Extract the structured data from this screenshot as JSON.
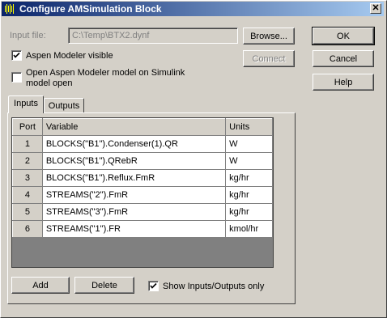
{
  "window": {
    "title": "Configure AMSimulation Block"
  },
  "input_file": {
    "label": "Input file:",
    "value": "C:\\Temp\\BTX2.dynf"
  },
  "buttons": {
    "browse": "Browse...",
    "connect": "Connect",
    "ok": "OK",
    "cancel": "Cancel",
    "help": "Help",
    "add": "Add",
    "delete": "Delete"
  },
  "options": {
    "aspen_visible": {
      "label": "Aspen Modeler visible",
      "checked": true
    },
    "open_on_simulink": {
      "label_line1": "Open Aspen Modeler model on Simulink",
      "label_line2": "model open",
      "checked": false
    },
    "show_io_only": {
      "label": "Show Inputs/Outputs only",
      "checked": true
    }
  },
  "tabs": [
    {
      "label": "Inputs",
      "active": true
    },
    {
      "label": "Outputs",
      "active": false
    }
  ],
  "table": {
    "headers": [
      "Port",
      "Variable",
      "Units"
    ],
    "rows": [
      {
        "port": "1",
        "variable": "BLOCKS(\"B1\").Condenser(1).QR",
        "units": "W"
      },
      {
        "port": "2",
        "variable": "BLOCKS(\"B1\").QRebR",
        "units": "W"
      },
      {
        "port": "3",
        "variable": "BLOCKS(\"B1\").Reflux.FmR",
        "units": "kg/hr"
      },
      {
        "port": "4",
        "variable": "STREAMS(\"2\").FmR",
        "units": "kg/hr"
      },
      {
        "port": "5",
        "variable": "STREAMS(\"3\").FmR",
        "units": "kg/hr"
      },
      {
        "port": "6",
        "variable": "STREAMS(\"1\").FR",
        "units": "kmol/hr"
      }
    ]
  }
}
